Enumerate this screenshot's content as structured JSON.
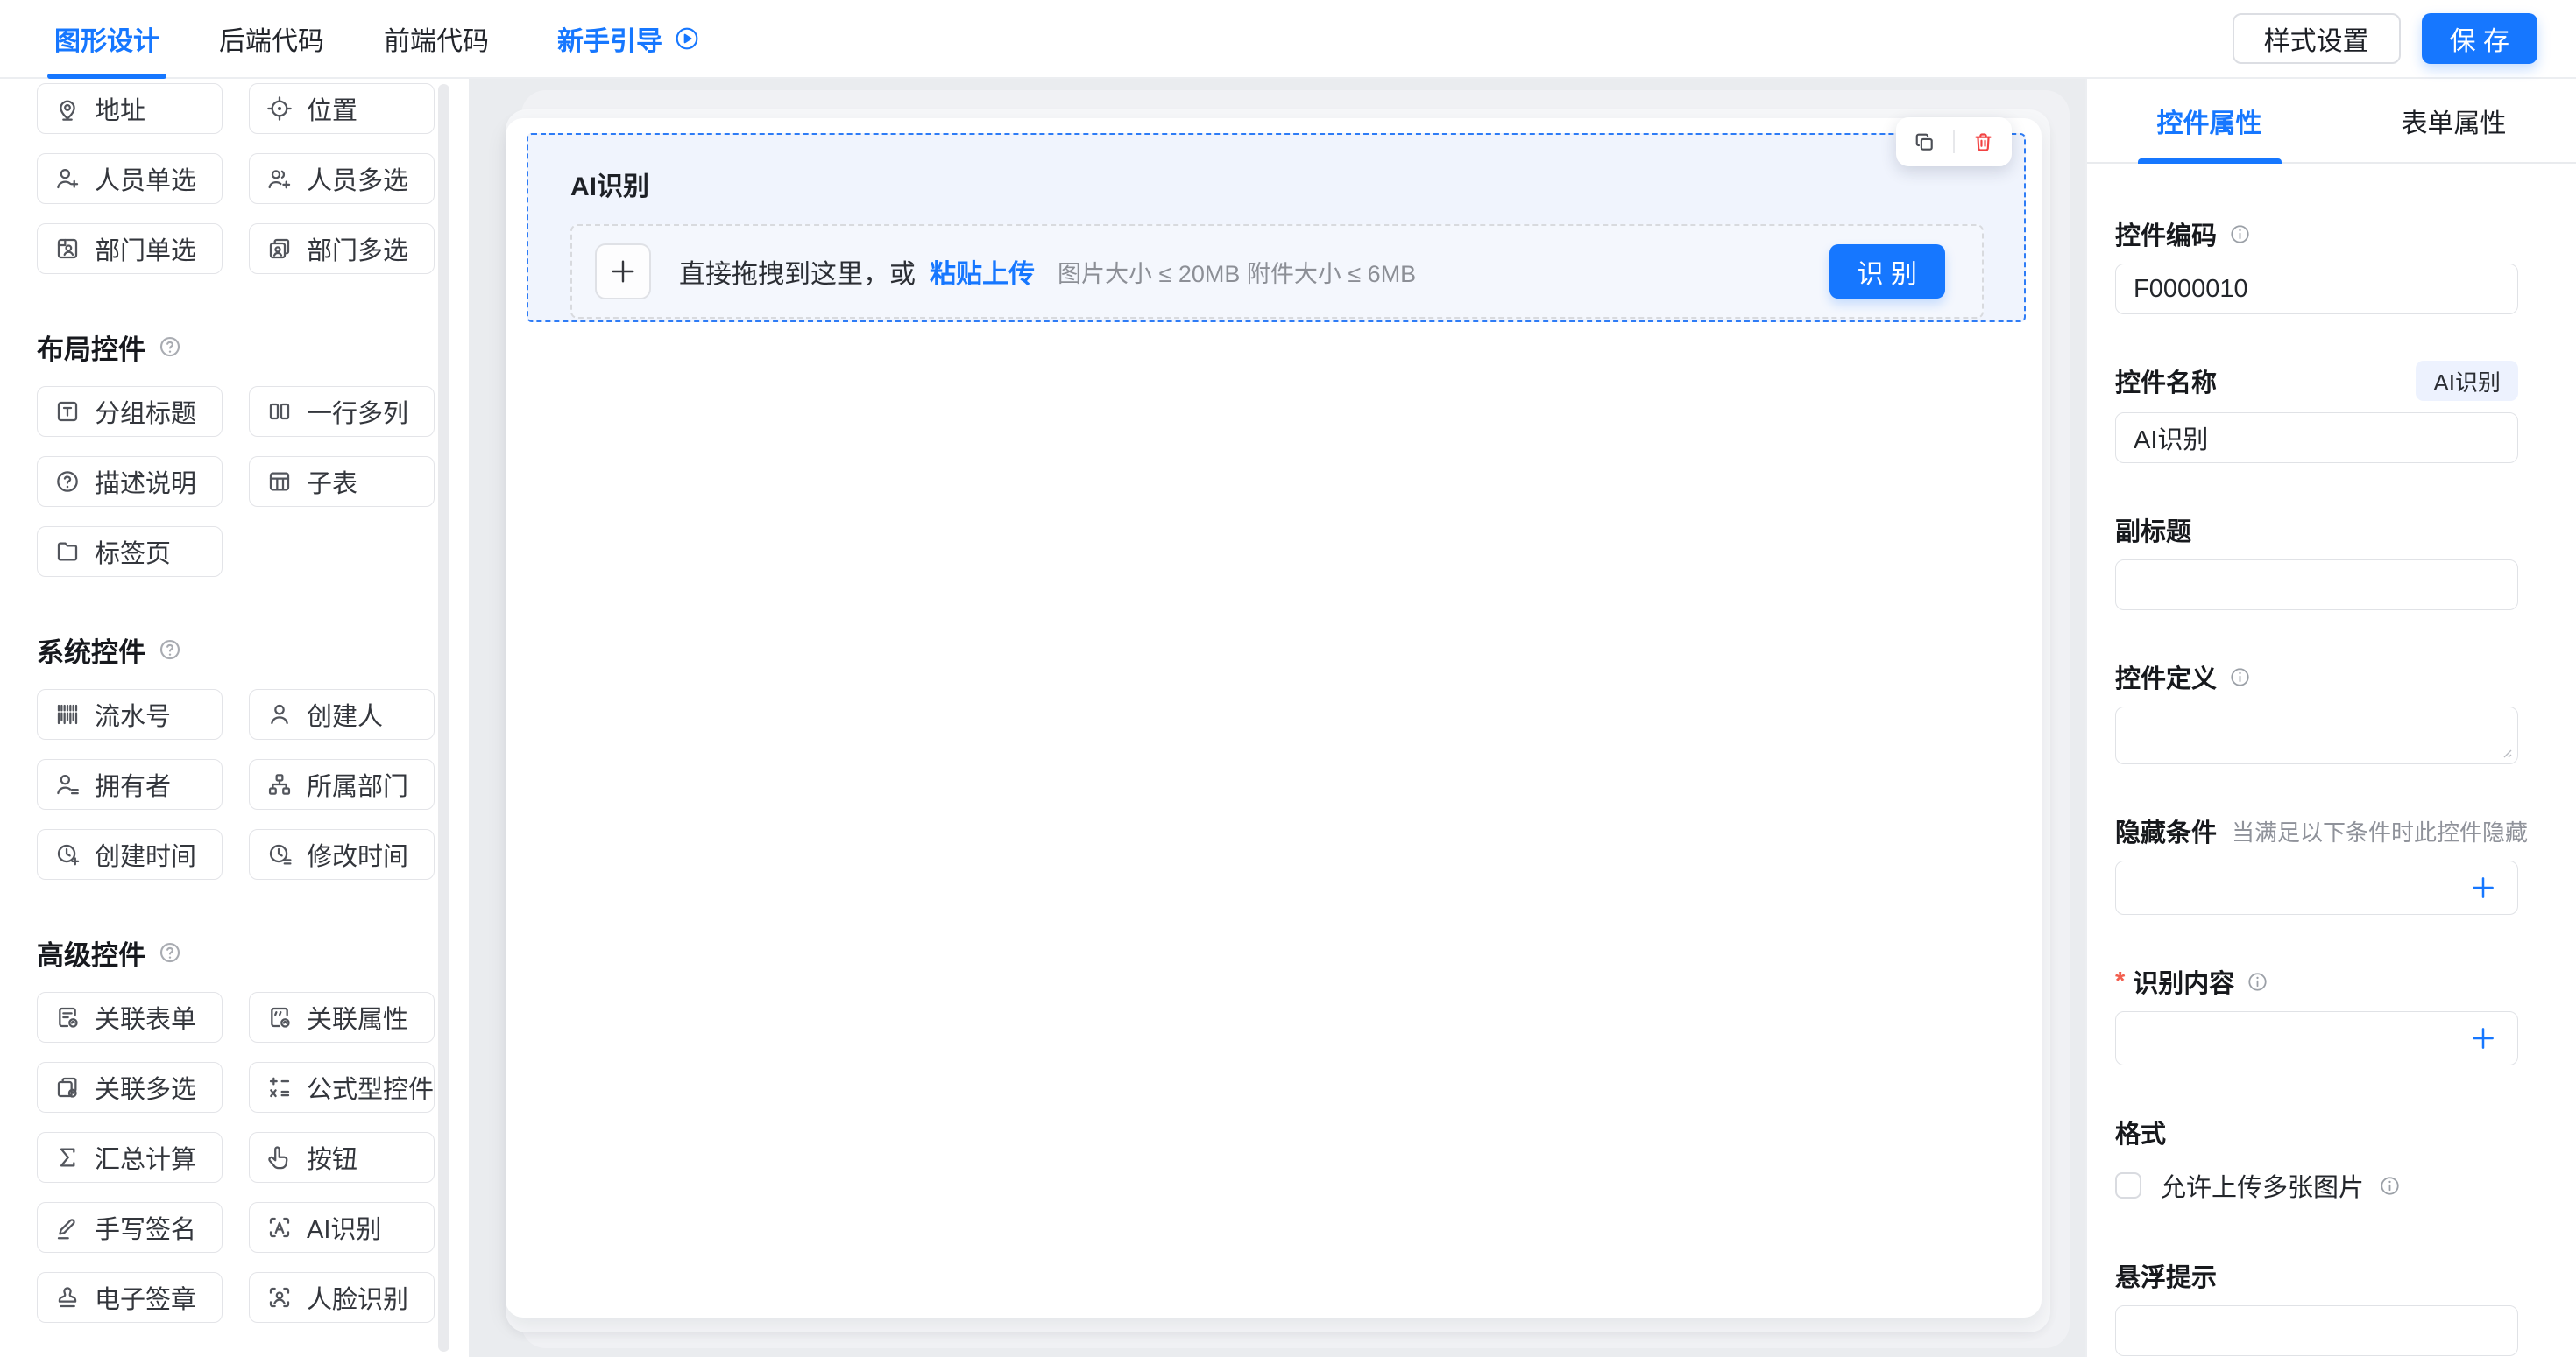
{
  "navbar": {
    "tabs": [
      {
        "label": "图形设计",
        "active": true
      },
      {
        "label": "后端代码",
        "active": false
      },
      {
        "label": "前端代码",
        "active": false
      }
    ],
    "guide": {
      "label": "新手引导",
      "icon": "play-circle"
    },
    "style_button": "样式设置",
    "save_button": "保 存"
  },
  "sidebar": {
    "sections": [
      {
        "header": "",
        "help_icon": false,
        "items": [
          {
            "label": "地址",
            "icon": "map-pin"
          },
          {
            "label": "位置",
            "icon": "location-target"
          },
          {
            "label": "人员单选",
            "icon": "user-plus"
          },
          {
            "label": "人员多选",
            "icon": "users-plus"
          },
          {
            "label": "部门单选",
            "icon": "dept-card"
          },
          {
            "label": "部门多选",
            "icon": "dept-cards"
          }
        ]
      },
      {
        "header": "布局控件",
        "help_icon": true,
        "items": [
          {
            "label": "分组标题",
            "icon": "group-title"
          },
          {
            "label": "一行多列",
            "icon": "columns"
          },
          {
            "label": "描述说明",
            "icon": "help-circle"
          },
          {
            "label": "子表",
            "icon": "subtable"
          },
          {
            "label": "标签页",
            "icon": "folder-tab"
          }
        ]
      },
      {
        "header": "系统控件",
        "help_icon": true,
        "items": [
          {
            "label": "流水号",
            "icon": "barcode"
          },
          {
            "label": "创建人",
            "icon": "user"
          },
          {
            "label": "拥有者",
            "icon": "user-owner"
          },
          {
            "label": "所属部门",
            "icon": "org-chart"
          },
          {
            "label": "创建时间",
            "icon": "clock-plus"
          },
          {
            "label": "修改时间",
            "icon": "clock-edit"
          }
        ]
      },
      {
        "header": "高级控件",
        "help_icon": true,
        "items": [
          {
            "label": "关联表单",
            "icon": "doc-link"
          },
          {
            "label": "关联属性",
            "icon": "attr-link"
          },
          {
            "label": "关联多选",
            "icon": "cards-link"
          },
          {
            "label": "公式型控件",
            "icon": "formula"
          },
          {
            "label": "汇总计算",
            "icon": "sigma"
          },
          {
            "label": "按钮",
            "icon": "tap"
          },
          {
            "label": "手写签名",
            "icon": "pen-sign"
          },
          {
            "label": "AI识别",
            "icon": "ai-scan"
          },
          {
            "label": "电子签章",
            "icon": "stamp"
          },
          {
            "label": "人脸识别",
            "icon": "face-scan"
          }
        ]
      }
    ]
  },
  "canvas": {
    "component_title": "AI识别",
    "toolbar_icons": [
      "copy",
      "trash"
    ],
    "upload": {
      "plus_icon": "plus",
      "drag_text": "直接拖拽到这里，或",
      "paste_link": "粘贴上传",
      "size_hint": "图片大小 ≤ 20MB 附件大小 ≤ 6MB",
      "recognize_button": "识 别"
    }
  },
  "panel": {
    "tabs": [
      {
        "label": "控件属性",
        "active": true
      },
      {
        "label": "表单属性",
        "active": false
      }
    ],
    "fields": {
      "code": {
        "label": "控件编码",
        "info_icon": "info-circle",
        "value": "F0000010"
      },
      "name": {
        "label": "控件名称",
        "tag": "AI识别",
        "value": "AI识别"
      },
      "subtitle": {
        "label": "副标题",
        "value": ""
      },
      "definition": {
        "label": "控件定义",
        "info_icon": "info-circle",
        "value": ""
      },
      "hide_condition": {
        "label": "隐藏条件",
        "hint": "当满足以下条件时此控件隐藏",
        "add_icon": "plus"
      },
      "recognize_content": {
        "label": "识别内容",
        "required_mark": "*",
        "info_icon": "info-circle",
        "add_icon": "plus"
      },
      "format": {
        "label": "格式",
        "checkbox_label": "允许上传多张图片",
        "checked": false,
        "info_icon": "info-circle"
      },
      "hover_tip": {
        "label": "悬浮提示",
        "value": ""
      }
    }
  },
  "colors": {
    "primary": "#1677ff",
    "danger": "#f24242",
    "required": "#f25f4f",
    "selection_bg": "#f0f4fd",
    "selection_border": "#2e7cf6",
    "canvas_bg": "#eaecef",
    "tag_bg": "#edf2fe"
  }
}
